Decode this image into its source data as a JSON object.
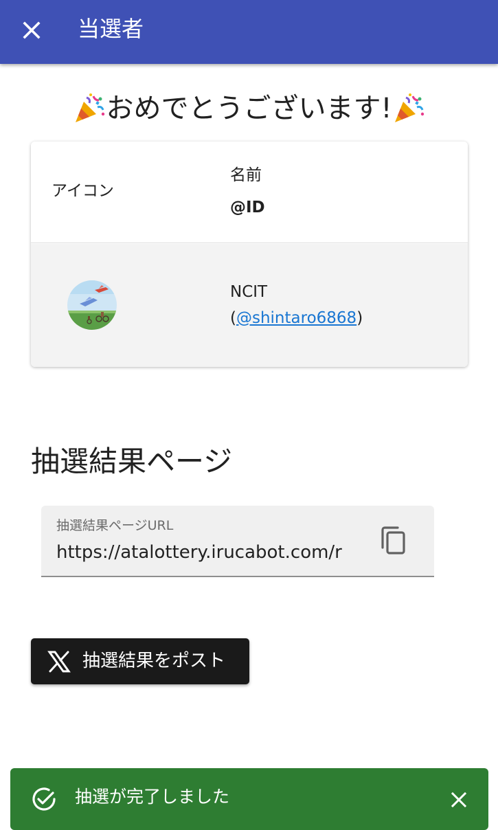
{
  "appbar": {
    "title": "当選者",
    "close_icon": "close-icon"
  },
  "congrats": {
    "text": "おめでとうございます!",
    "icon": "party-popper-icon"
  },
  "winners_table": {
    "headers": {
      "icon": "アイコン",
      "name": "名前",
      "id": "@ID"
    },
    "rows": [
      {
        "name": "NCIT",
        "id_prefix": "(",
        "id_handle": "@shintaro6868",
        "id_suffix": ")"
      }
    ]
  },
  "result_page": {
    "section_title": "抽選結果ページ",
    "url_label": "抽選結果ページURL",
    "url_value": "https://atalottery.irucabot.com/r",
    "copy_icon": "copy-icon"
  },
  "post_button": {
    "label": "抽選結果をポスト",
    "icon": "x-logo-icon"
  },
  "snackbar": {
    "message": "抽選が完了しました",
    "icon": "check-circle-icon",
    "close_icon": "close-icon"
  },
  "colors": {
    "appbar": "#3f51b5",
    "link": "#1976d2",
    "post_button": "#1a1a1a",
    "snackbar": "#2e7d32"
  }
}
